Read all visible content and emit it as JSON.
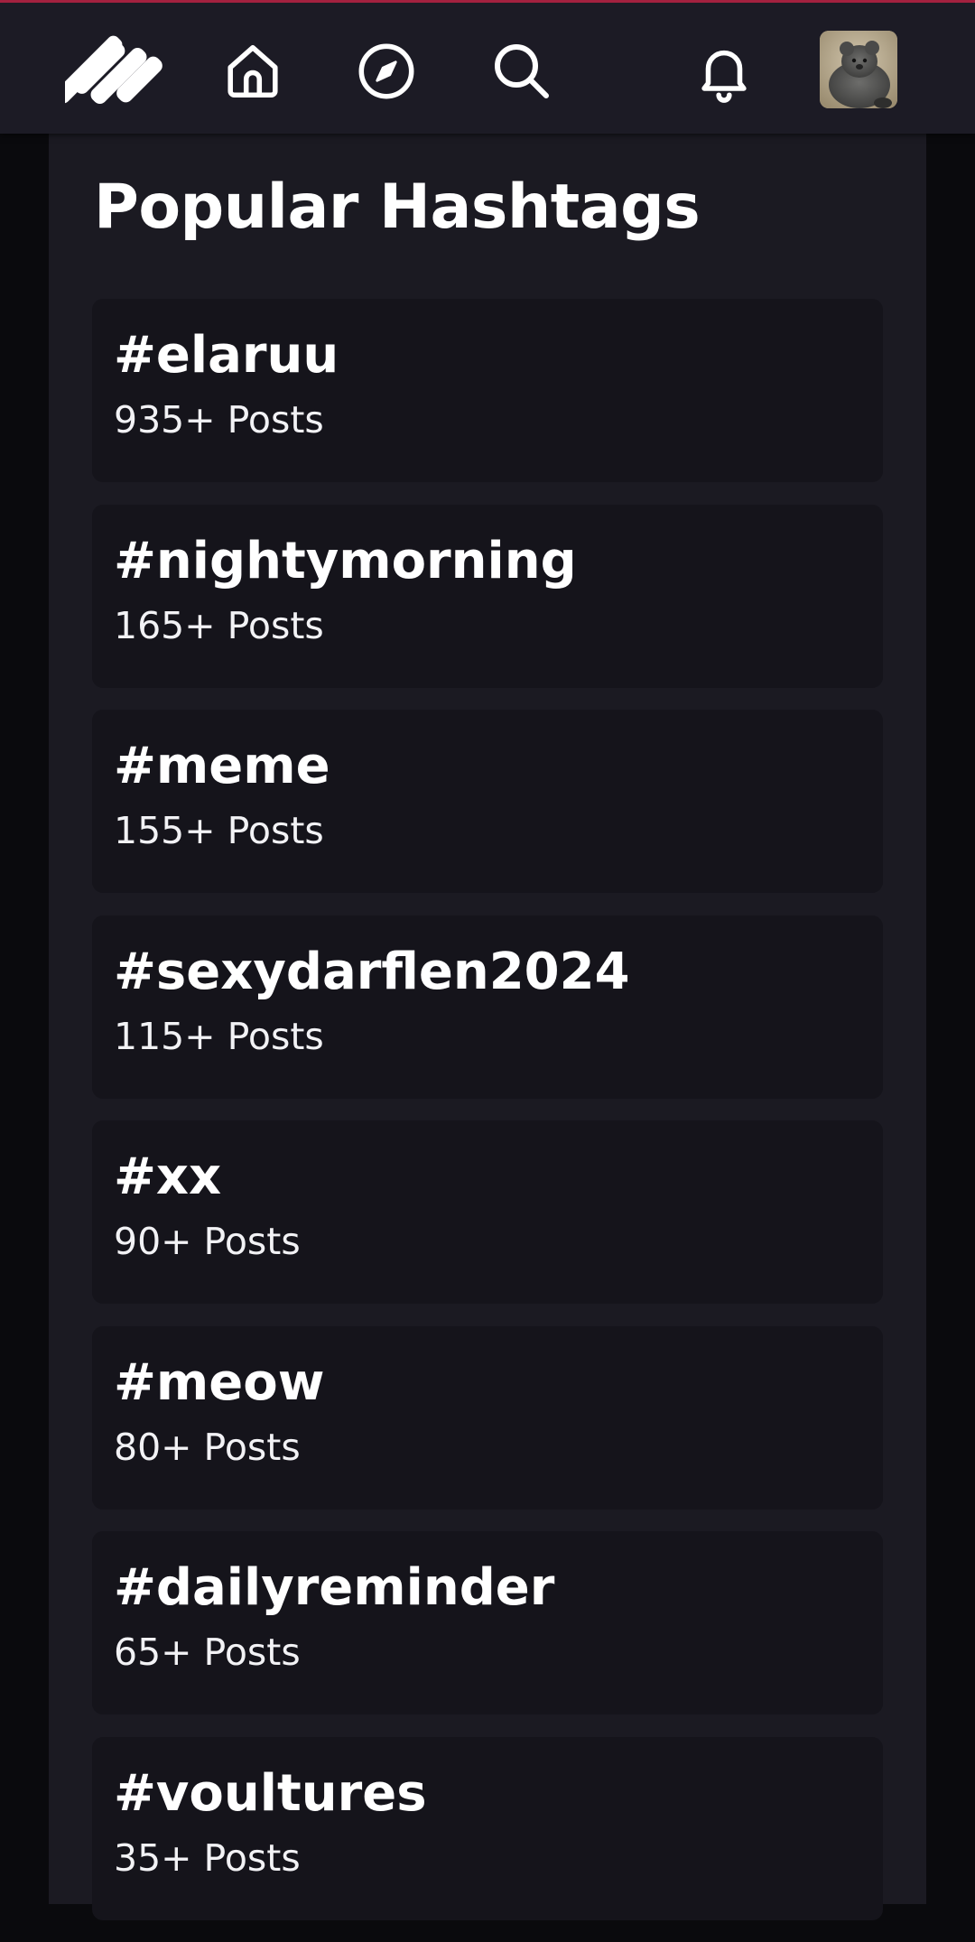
{
  "nav": {
    "items": [
      {
        "icon": "logo-icon"
      },
      {
        "icon": "home-icon"
      },
      {
        "icon": "compass-icon"
      },
      {
        "icon": "search-icon"
      },
      {
        "icon": "bell-icon"
      },
      {
        "icon": "avatar"
      }
    ],
    "accent_color": "#a3213f"
  },
  "page": {
    "title": "Popular Hashtags"
  },
  "hashtags": [
    {
      "tag": "#elaruu",
      "count": "935+ Posts"
    },
    {
      "tag": "#nightymorning",
      "count": "165+ Posts"
    },
    {
      "tag": "#meme",
      "count": "155+ Posts"
    },
    {
      "tag": "#sexydarflen2024",
      "count": "115+ Posts"
    },
    {
      "tag": "#xx",
      "count": "90+ Posts"
    },
    {
      "tag": "#meow",
      "count": "80+ Posts"
    },
    {
      "tag": "#dailyreminder",
      "count": "65+ Posts"
    },
    {
      "tag": "#voultures",
      "count": "35+ Posts"
    }
  ]
}
